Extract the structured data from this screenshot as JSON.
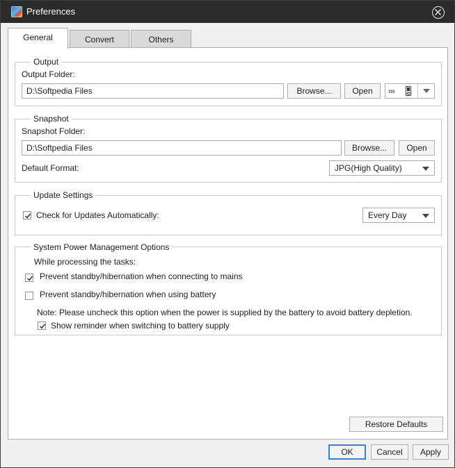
{
  "window": {
    "title": "Preferences"
  },
  "tabs": [
    {
      "label": "General",
      "active": true
    },
    {
      "label": "Convert",
      "active": false
    },
    {
      "label": "Others",
      "active": false
    }
  ],
  "output": {
    "legend": "Output",
    "folder_label": "Output Folder:",
    "folder_value": "D:\\Softpedia Files",
    "browse_label": "Browse...",
    "open_label": "Open",
    "device_glyph": "›››"
  },
  "snapshot": {
    "legend": "Snapshot",
    "folder_label": "Snapshot Folder:",
    "folder_value": "D:\\Softpedia Files",
    "browse_label": "Browse...",
    "open_label": "Open",
    "format_label": "Default Format:",
    "format_value": "JPG(High Quality)"
  },
  "update": {
    "legend": "Update Settings",
    "check_label": "Check for Updates Automatically:",
    "checked": true,
    "frequency_value": "Every Day"
  },
  "power": {
    "legend": "System Power Management Options",
    "intro": "While processing the tasks:",
    "mains_label": "Prevent standby/hibernation when connecting to mains",
    "mains_checked": true,
    "battery_label": "Prevent standby/hibernation when using battery",
    "battery_checked": false,
    "note": "Note: Please uncheck this option when the power is supplied by the battery to avoid battery depletion.",
    "reminder_label": "Show reminder when switching to battery supply",
    "reminder_checked": true
  },
  "buttons": {
    "restore_defaults": "Restore Defaults",
    "ok": "OK",
    "cancel": "Cancel",
    "apply": "Apply"
  },
  "icons": {
    "app": "app-logo-icon",
    "close": "close-circle-icon",
    "device": "portable-device-icon",
    "dropdown": "chevron-down-icon",
    "check": "checkmark-icon"
  }
}
